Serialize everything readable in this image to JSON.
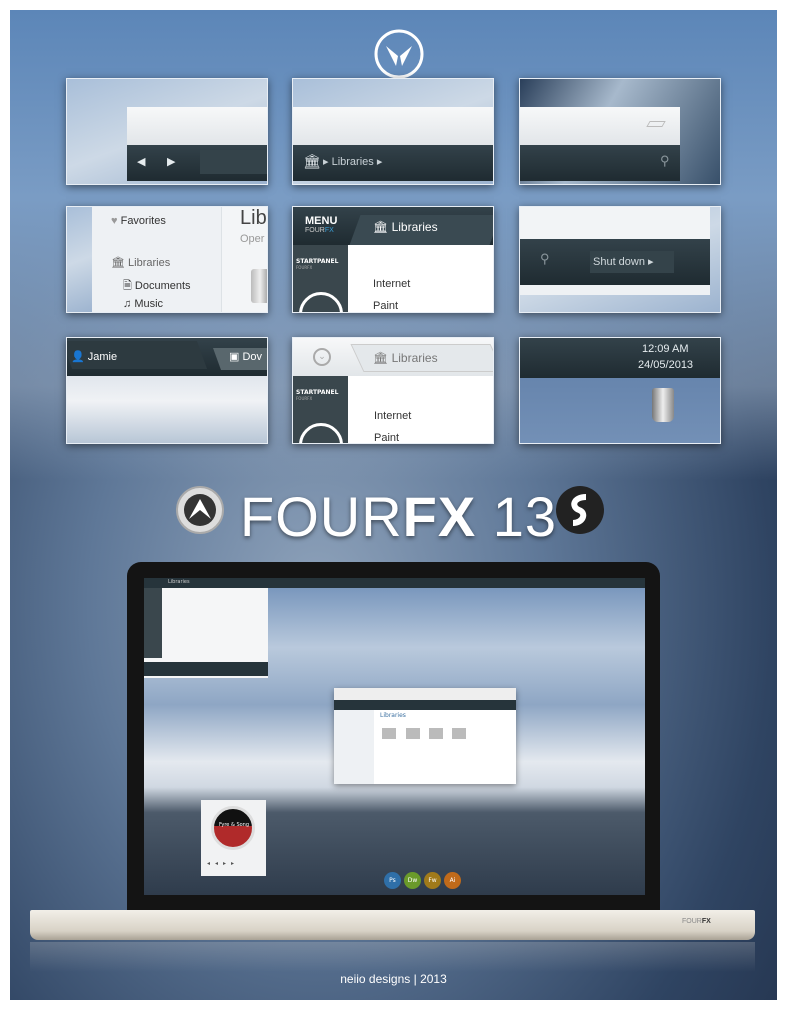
{
  "panels": {
    "breadcrumb": {
      "label": "Libraries"
    },
    "sidebar": {
      "favorites": "Favorites",
      "libraries": "Libraries",
      "documents": "Documents",
      "music": "Music",
      "heading": "Libr",
      "subheading": "Oper"
    },
    "menu": {
      "menu": "MENU",
      "brand_a": "FOUR",
      "brand_b": "FX",
      "libraries": "Libraries",
      "startpanel": "STARTPANEL",
      "startpanel_sub": "FOURFX",
      "items": [
        "Internet",
        "Paint"
      ]
    },
    "shutdown": {
      "label": "Shut down"
    },
    "taskbar": {
      "user": "Jamie",
      "downloads": "Dov"
    },
    "startpanel2": {
      "libraries": "Libraries",
      "startpanel": "STARTPANEL",
      "startpanel_sub": "FOURFX",
      "items": [
        "Internet",
        "Paint"
      ]
    },
    "clock": {
      "time": "12:09 AM",
      "date": "24/05/2013"
    }
  },
  "title": {
    "light": "FOUR",
    "bold": "FX",
    "version": "13"
  },
  "laptop": {
    "brand_a": "FOUR",
    "brand_b": "FX",
    "window_title": "Libraries",
    "player_track": "Fyre & Song",
    "dock": [
      "Ps",
      "Dw",
      "Fw",
      "Ai"
    ]
  },
  "footer": "neiio designs | 2013",
  "colors": {
    "accent": "#3aa0d8",
    "dark_bar": "#26343b",
    "light_bar": "#eef0f2"
  }
}
